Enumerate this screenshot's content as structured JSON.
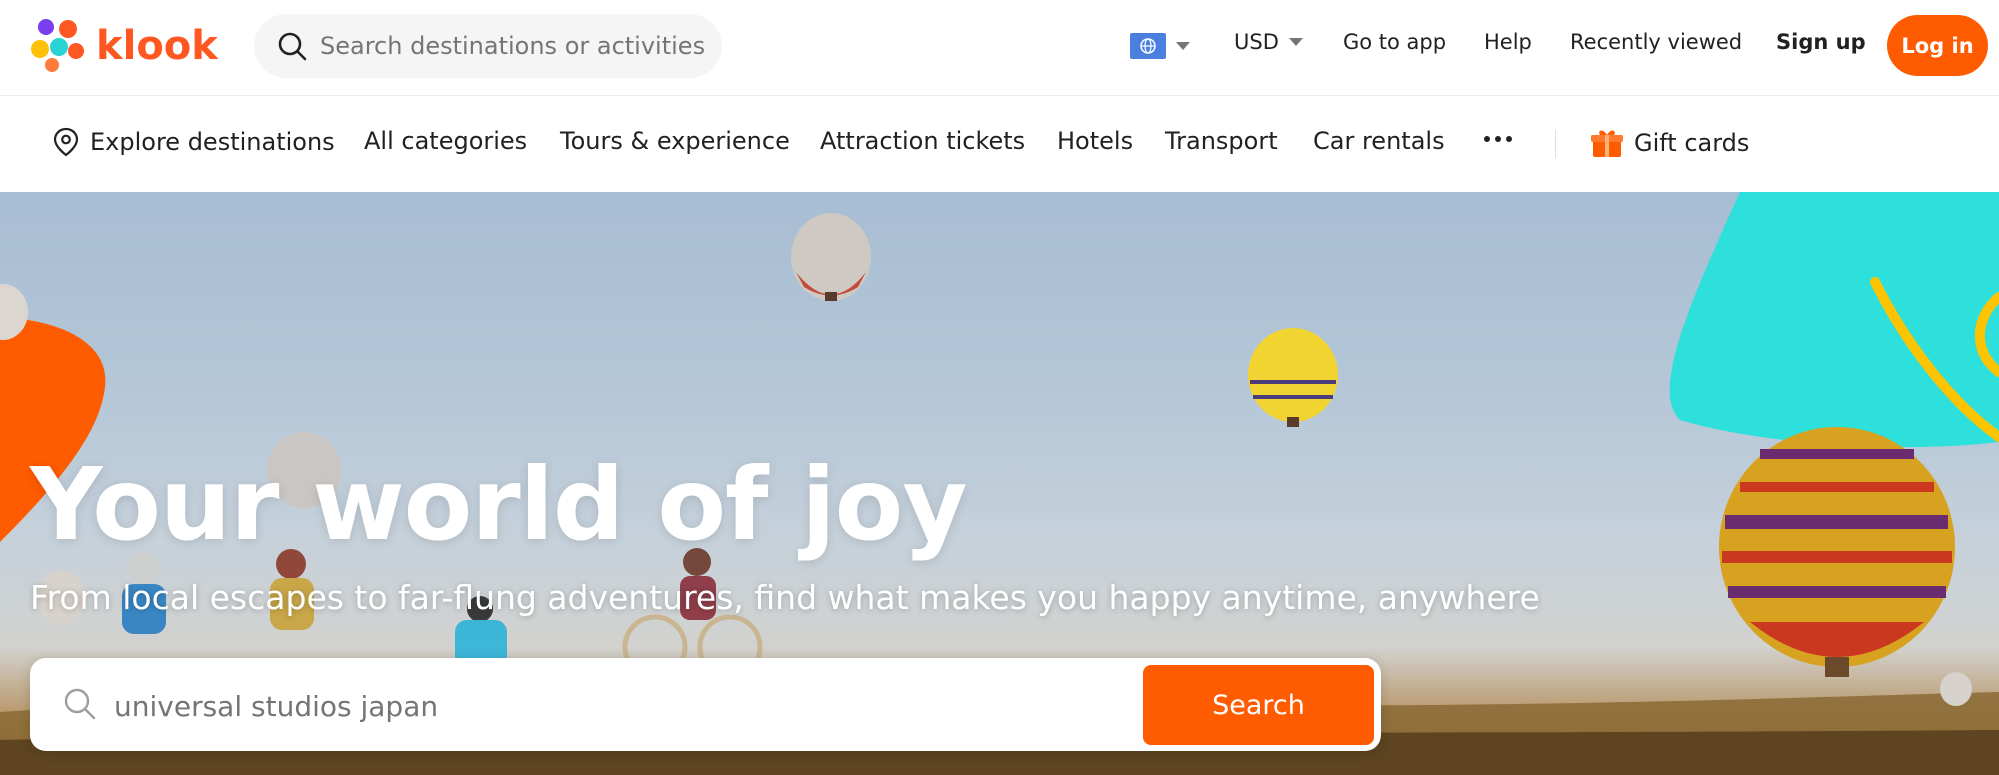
{
  "brand": {
    "name": "klook",
    "accent": "#ff5b00"
  },
  "header": {
    "search_placeholder": "Search destinations or activities",
    "currency": "USD",
    "links": [
      "Go to app",
      "Help",
      "Recently viewed",
      "Sign up"
    ],
    "login_label": "Log in"
  },
  "nav": {
    "explore_label": "Explore destinations",
    "categories": [
      "All categories",
      "Tours & experience",
      "Attraction tickets",
      "Hotels",
      "Transport",
      "Car rentals"
    ],
    "gift_label": "Gift cards"
  },
  "hero": {
    "title": "Your world of joy",
    "subtitle": "From local escapes to far-flung adventures, find what makes you happy anytime, anywhere",
    "search_placeholder": "universal studios japan",
    "search_button": "Search"
  },
  "icons": {
    "search": "search-icon",
    "globe": "globe-icon",
    "location": "location-pin-icon",
    "more": "more-dots-icon",
    "gift": "gift-icon"
  }
}
